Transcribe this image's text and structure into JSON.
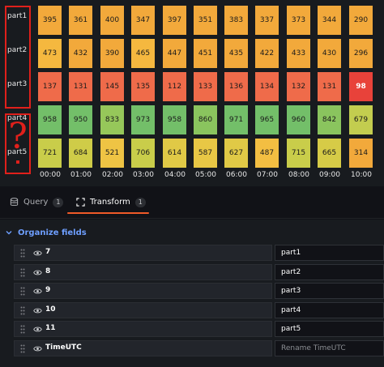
{
  "heatmap": {
    "row_labels": [
      "part1",
      "part2",
      "part3",
      "part4",
      "part5"
    ],
    "time_labels": [
      "00:00",
      "01:00",
      "02:00",
      "03:00",
      "04:00",
      "05:00",
      "06:00",
      "07:00",
      "08:00",
      "09:00",
      "10:00"
    ],
    "rows": [
      {
        "values": [
          "395",
          "361",
          "400",
          "347",
          "397",
          "351",
          "383",
          "337",
          "373",
          "344",
          "290"
        ],
        "colors": [
          "#f2a93b",
          "#f2a93b",
          "#f2a93b",
          "#f2a93b",
          "#f2a93b",
          "#f2a93b",
          "#f2a93b",
          "#f2a93b",
          "#f2a93b",
          "#f2a93b",
          "#f2a93b"
        ]
      },
      {
        "values": [
          "473",
          "432",
          "390",
          "465",
          "447",
          "451",
          "435",
          "422",
          "433",
          "430",
          "296"
        ],
        "colors": [
          "#f5b83f",
          "#f2a93b",
          "#f2a93b",
          "#f5b83f",
          "#f2a93b",
          "#f2a93b",
          "#f2a93b",
          "#f2a93b",
          "#f2a93b",
          "#f2a93b",
          "#f2a93b"
        ]
      },
      {
        "values": [
          "137",
          "131",
          "145",
          "135",
          "112",
          "133",
          "136",
          "134",
          "132",
          "131",
          "98"
        ],
        "colors": [
          "#ef6b4a",
          "#ef6b4a",
          "#ef6b4a",
          "#ef6b4a",
          "#ef6b4a",
          "#ef6b4a",
          "#ef6b4a",
          "#ef6b4a",
          "#ef6b4a",
          "#ef6b4a",
          "#e8423a"
        ]
      },
      {
        "values": [
          "958",
          "950",
          "833",
          "973",
          "958",
          "860",
          "971",
          "965",
          "960",
          "842",
          "679"
        ],
        "colors": [
          "#73bf69",
          "#73bf69",
          "#96c75a",
          "#73bf69",
          "#73bf69",
          "#8ac45e",
          "#73bf69",
          "#73bf69",
          "#73bf69",
          "#8ac45e",
          "#c3cd4f"
        ]
      },
      {
        "values": [
          "721",
          "684",
          "521",
          "706",
          "614",
          "587",
          "627",
          "487",
          "715",
          "665",
          "314"
        ],
        "colors": [
          "#c9cd4a",
          "#cfcc48",
          "#efc444",
          "#c9cd4a",
          "#e0c946",
          "#e8c745",
          "#e0c946",
          "#f3be42",
          "#c9cd4a",
          "#d6cb47",
          "#f2a93b"
        ]
      }
    ],
    "question_mark": "?"
  },
  "tabs": [
    {
      "label": "Query",
      "count": "1",
      "icon": "database-icon"
    },
    {
      "label": "Transform",
      "count": "1",
      "icon": "transform-icon"
    }
  ],
  "organize": {
    "title": "Organize fields",
    "fields": [
      {
        "name": "7",
        "value": "part1",
        "placeholder": ""
      },
      {
        "name": "8",
        "value": "part2",
        "placeholder": ""
      },
      {
        "name": "9",
        "value": "part3",
        "placeholder": ""
      },
      {
        "name": "10",
        "value": "part4",
        "placeholder": ""
      },
      {
        "name": "11",
        "value": "part5",
        "placeholder": ""
      },
      {
        "name": "TimeUTC",
        "value": "",
        "placeholder": "Rename TimeUTC"
      }
    ]
  },
  "colors": {
    "accent": "#f05a28",
    "link": "#6e9fff",
    "annotation": "#e0201b"
  }
}
